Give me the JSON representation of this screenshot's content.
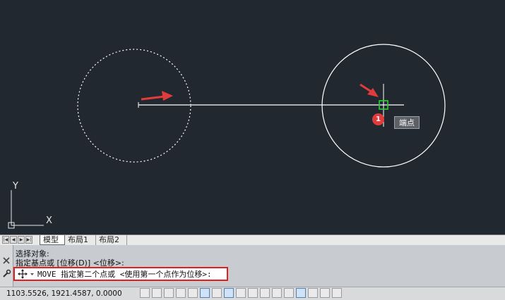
{
  "tooltip": {
    "label": "端点"
  },
  "marker": {
    "number": "1"
  },
  "tabs": [
    {
      "label": "模型"
    },
    {
      "label": "布局1"
    },
    {
      "label": "布局2"
    }
  ],
  "command": {
    "history": [
      "选择对象:",
      "指定基点或 [位移(D)] <位移>:"
    ],
    "prompt": "MOVE 指定第二个点或 <使用第一个点作为位移>:"
  },
  "status": {
    "coordinates": "1103.5526, 1921.4587, 0.0000"
  },
  "ucs": {
    "x_label": "X",
    "y_label": "Y"
  },
  "colors": {
    "canvas": "#212830",
    "geometry": "#ffffff",
    "arrow": "#e23b3b",
    "snap_marker": "#2fd12f",
    "highlight_box": "#e02020"
  }
}
